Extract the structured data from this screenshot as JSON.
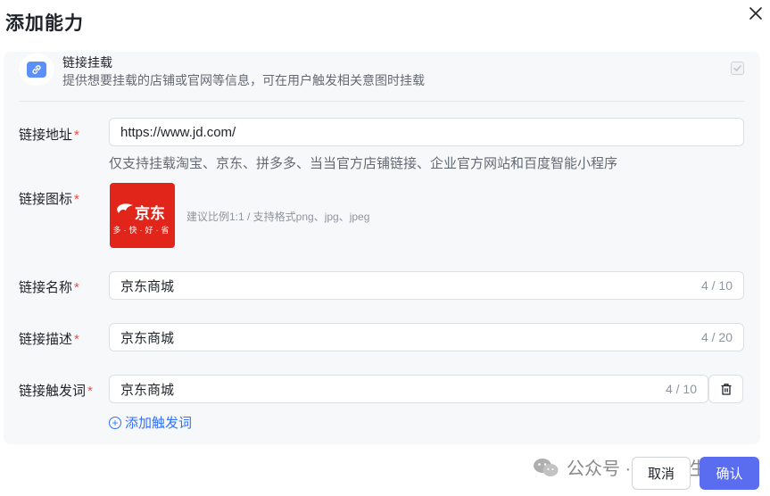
{
  "dialog": {
    "title": "添加能力"
  },
  "capability": {
    "title": "链接挂载",
    "description": "提供想要挂载的店铺或官网等信息，可在用户触发相关意图时挂载",
    "checked": true
  },
  "form": {
    "url": {
      "label": "链接地址",
      "value": "https://www.jd.com/",
      "hint": "仅支持挂载淘宝、京东、拼多多、当当官方店铺链接、企业官方网站和百度智能小程序"
    },
    "icon": {
      "label": "链接图标",
      "logo_text": "京东",
      "logo_tagline": "多·快·好·省",
      "hint": "建议比例1:1 / 支持格式png、jpg、jpeg"
    },
    "name": {
      "label": "链接名称",
      "value": "京东商城",
      "count": "4 / 10"
    },
    "description": {
      "label": "链接描述",
      "value": "京东商城",
      "count": "4 / 20"
    },
    "trigger": {
      "label": "链接触发词",
      "value": "京东商城",
      "count": "4 / 10"
    },
    "required_mark": "*",
    "add_trigger_label": "添加触发词"
  },
  "watermark": {
    "text": "公众号 · 数字众生",
    "icon": "wechat-icon"
  },
  "footer": {
    "cancel_label": "取消",
    "confirm_label": "确认"
  },
  "colors": {
    "primary": "#5a6cf0",
    "link": "#3370ff",
    "required": "#f54a45",
    "panel_bg": "#f7f8fa",
    "jd_red": "#e1251b"
  }
}
